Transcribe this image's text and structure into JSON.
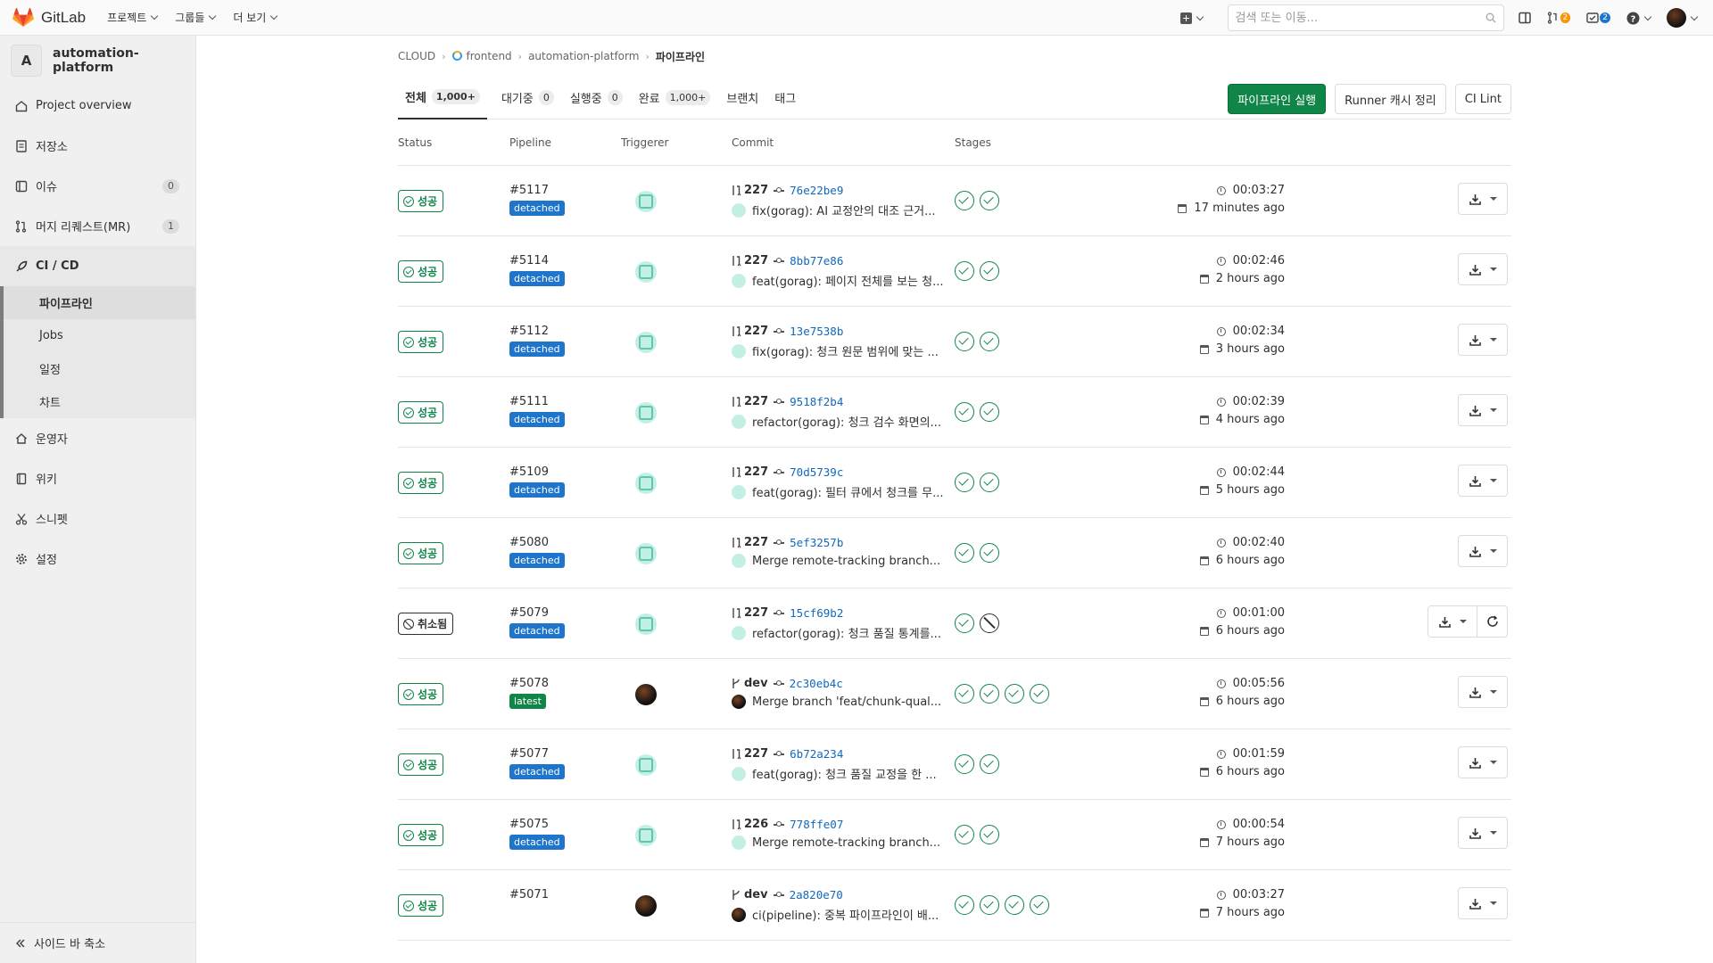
{
  "topbar": {
    "brand": "GitLab",
    "nav": [
      "프로젝트",
      "그룹들",
      "더 보기"
    ],
    "search_placeholder": "검색 또는 이동...",
    "mr_count": "2",
    "todo_count": "2"
  },
  "sidebar": {
    "project_initial": "A",
    "project_name": "automation-platform",
    "items": [
      {
        "label": "Project overview",
        "icon": "home-icon"
      },
      {
        "label": "저장소",
        "icon": "doc-icon"
      },
      {
        "label": "이슈",
        "icon": "issues-icon",
        "count": "0"
      },
      {
        "label": "머지 리퀘스트(MR)",
        "icon": "merge-request-icon",
        "count": "1"
      },
      {
        "label": "CI / CD",
        "icon": "rocket-icon"
      },
      {
        "label": "운영자",
        "icon": "cloud-icon"
      },
      {
        "label": "위키",
        "icon": "book-icon"
      },
      {
        "label": "스니펫",
        "icon": "scissors-icon"
      },
      {
        "label": "설정",
        "icon": "gear-icon"
      }
    ],
    "cicd_sub": [
      "파이프라인",
      "Jobs",
      "일정",
      "차트"
    ],
    "collapse_label": "사이드 바 축소"
  },
  "breadcrumb": [
    "CLOUD",
    "frontend",
    "automation-platform",
    "파이프라인"
  ],
  "tabs": [
    {
      "label": "전체",
      "count": "1,000+"
    },
    {
      "label": "대기중",
      "count": "0"
    },
    {
      "label": "실행중",
      "count": "0"
    },
    {
      "label": "완료",
      "count": "1,000+"
    },
    {
      "label": "브랜치",
      "count": ""
    },
    {
      "label": "태그",
      "count": ""
    }
  ],
  "actions": {
    "run": "파이프라인 실행",
    "clear_cache": "Runner 캐시 정리",
    "lint": "CI Lint"
  },
  "columns": [
    "Status",
    "Pipeline",
    "Triggerer",
    "Commit",
    "Stages"
  ],
  "colors": {
    "success": "#108548",
    "primary_button": "#108548",
    "detached": "#1f75cb",
    "link": "#1068bf"
  },
  "rows": [
    {
      "status": "성공",
      "state": "success",
      "id": "#5117",
      "tag": "detached",
      "triggerer": "bot",
      "ref_type": "mr",
      "ref": "227",
      "sha": "76e22be9",
      "message": "fix(gorag): AI 교정안의 대조 근거...",
      "stages": [
        "success",
        "success"
      ],
      "duration": "00:03:27",
      "ago": "17 minutes ago"
    },
    {
      "status": "성공",
      "state": "success",
      "id": "#5114",
      "tag": "detached",
      "triggerer": "bot",
      "ref_type": "mr",
      "ref": "227",
      "sha": "8bb77e86",
      "message": "feat(gorag): 페이지 전체를 보는 청...",
      "stages": [
        "success",
        "success"
      ],
      "duration": "00:02:46",
      "ago": "2 hours ago"
    },
    {
      "status": "성공",
      "state": "success",
      "id": "#5112",
      "tag": "detached",
      "triggerer": "bot",
      "ref_type": "mr",
      "ref": "227",
      "sha": "13e7538b",
      "message": "fix(gorag): 청크 원문 범위에 맞는 ...",
      "stages": [
        "success",
        "success"
      ],
      "duration": "00:02:34",
      "ago": "3 hours ago"
    },
    {
      "status": "성공",
      "state": "success",
      "id": "#5111",
      "tag": "detached",
      "triggerer": "bot",
      "ref_type": "mr",
      "ref": "227",
      "sha": "9518f2b4",
      "message": "refactor(gorag): 청크 검수 화면의...",
      "stages": [
        "success",
        "success"
      ],
      "duration": "00:02:39",
      "ago": "4 hours ago"
    },
    {
      "status": "성공",
      "state": "success",
      "id": "#5109",
      "tag": "detached",
      "triggerer": "bot",
      "ref_type": "mr",
      "ref": "227",
      "sha": "70d5739c",
      "message": "feat(gorag): 필터 큐에서 청크를 무...",
      "stages": [
        "success",
        "success"
      ],
      "duration": "00:02:44",
      "ago": "5 hours ago"
    },
    {
      "status": "성공",
      "state": "success",
      "id": "#5080",
      "tag": "detached",
      "triggerer": "bot",
      "ref_type": "mr",
      "ref": "227",
      "sha": "5ef3257b",
      "message": "Merge remote-tracking branch...",
      "stages": [
        "success",
        "success"
      ],
      "duration": "00:02:40",
      "ago": "6 hours ago"
    },
    {
      "status": "취소됨",
      "state": "canceled",
      "id": "#5079",
      "tag": "detached",
      "triggerer": "bot",
      "ref_type": "mr",
      "ref": "227",
      "sha": "15cf69b2",
      "message": "refactor(gorag): 청크 품질 통계를...",
      "stages": [
        "success",
        "canceled"
      ],
      "duration": "00:01:00",
      "ago": "6 hours ago",
      "retry": true
    },
    {
      "status": "성공",
      "state": "success",
      "id": "#5078",
      "tag": "latest",
      "triggerer": "user",
      "ref_type": "branch",
      "ref": "dev",
      "sha": "2c30eb4c",
      "message": "Merge branch 'feat/chunk-qual...",
      "stages": [
        "success",
        "success",
        "success",
        "success"
      ],
      "duration": "00:05:56",
      "ago": "6 hours ago"
    },
    {
      "status": "성공",
      "state": "success",
      "id": "#5077",
      "tag": "detached",
      "triggerer": "bot",
      "ref_type": "mr",
      "ref": "227",
      "sha": "6b72a234",
      "message": "feat(gorag): 청크 품질 교정을 한 ...",
      "stages": [
        "success",
        "success"
      ],
      "duration": "00:01:59",
      "ago": "6 hours ago"
    },
    {
      "status": "성공",
      "state": "success",
      "id": "#5075",
      "tag": "detached",
      "triggerer": "bot",
      "ref_type": "mr",
      "ref": "226",
      "sha": "778ffe07",
      "message": "Merge remote-tracking branch...",
      "stages": [
        "success",
        "success"
      ],
      "duration": "00:00:54",
      "ago": "7 hours ago"
    },
    {
      "status": "성공",
      "state": "success",
      "id": "#5071",
      "tag": "",
      "triggerer": "user",
      "ref_type": "branch",
      "ref": "dev",
      "sha": "2a820e70",
      "message": "ci(pipeline): 중복 파이프라인이 배...",
      "stages": [
        "success",
        "success",
        "success",
        "success"
      ],
      "duration": "00:03:27",
      "ago": "7 hours ago"
    }
  ]
}
